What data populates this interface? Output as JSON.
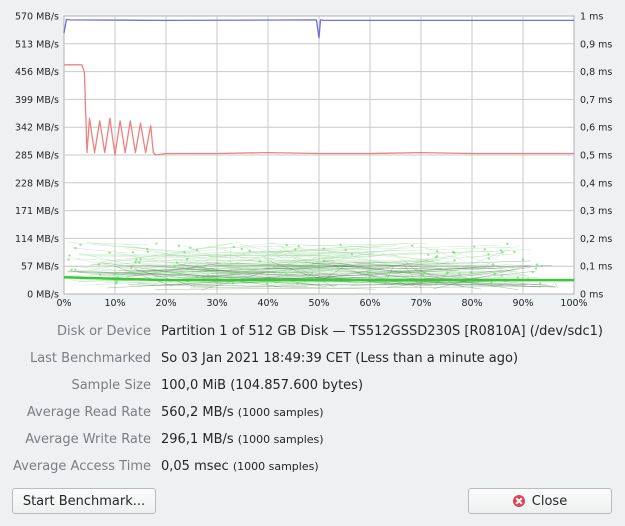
{
  "chart_data": {
    "type": "line",
    "left_axis_ticks": [
      "570 MB/s",
      "513 MB/s",
      "456 MB/s",
      "399 MB/s",
      "342 MB/s",
      "285 MB/s",
      "228 MB/s",
      "171 MB/s",
      "114 MB/s",
      "57 MB/s",
      "0 MB/s"
    ],
    "right_axis_ticks": [
      "1 ms",
      "0,9 ms",
      "0,8 ms",
      "0,7 ms",
      "0,6 ms",
      "0,5 ms",
      "0,4 ms",
      "0,3 ms",
      "0,2 ms",
      "0,1 ms",
      "0 ms"
    ],
    "x_ticks": [
      "0%",
      "10%",
      "20%",
      "30%",
      "40%",
      "50%",
      "60%",
      "70%",
      "80%",
      "90%",
      "100%"
    ],
    "ylim": [
      0,
      570
    ],
    "y2lim": [
      0,
      1
    ],
    "xlim": [
      0,
      100
    ],
    "grid": true,
    "series": [
      {
        "color": "#6f6fe0",
        "axis": "left",
        "x": [
          0,
          0.5,
          1,
          20,
          49.5,
          50,
          50.3,
          51,
          100
        ],
        "values": [
          535,
          563,
          562,
          561,
          562,
          525,
          562,
          561,
          561
        ]
      },
      {
        "color": "#f08080",
        "axis": "left",
        "x": [
          0,
          3.5,
          4,
          4.5,
          5,
          6,
          7,
          8,
          9,
          10,
          11,
          12,
          13,
          14,
          15,
          16,
          17,
          17.5,
          18,
          20,
          30,
          40,
          50,
          60,
          70,
          80,
          90,
          100
        ],
        "values": [
          470,
          470,
          455,
          290,
          360,
          290,
          355,
          290,
          360,
          285,
          355,
          290,
          355,
          290,
          350,
          290,
          345,
          290,
          285,
          288,
          288,
          290,
          288,
          288,
          290,
          288,
          288,
          288
        ]
      },
      {
        "color": "#33cc33",
        "axis": "right",
        "x": [
          0,
          10,
          20,
          30,
          40,
          50,
          60,
          70,
          80,
          90,
          100
        ],
        "values": [
          0.06,
          0.055,
          0.05,
          0.05,
          0.05,
          0.05,
          0.05,
          0.05,
          0.05,
          0.05,
          0.05
        ]
      }
    ]
  },
  "info": {
    "disk_label": "Disk or Device",
    "disk_value": "Partition 1 of 512 GB Disk — TS512GSSD230S [R0810A] (/dev/sdc1)",
    "last_label": "Last Benchmarked",
    "last_value": "So 03 Jan 2021 18:49:39 CET (Less than a minute ago)",
    "sample_label": "Sample Size",
    "sample_value": "100,0 MiB (104.857.600 bytes)",
    "read_label": "Average Read Rate",
    "read_value": "560,2 MB/s",
    "read_note": "(1000 samples)",
    "write_label": "Average Write Rate",
    "write_value": "296,1 MB/s",
    "write_note": "(1000 samples)",
    "access_label": "Average Access Time",
    "access_value": "0,05 msec",
    "access_note": "(1000 samples)"
  },
  "buttons": {
    "start_label": "Start Benchmark...",
    "close_label": "Close",
    "close_icon": "close-icon"
  }
}
